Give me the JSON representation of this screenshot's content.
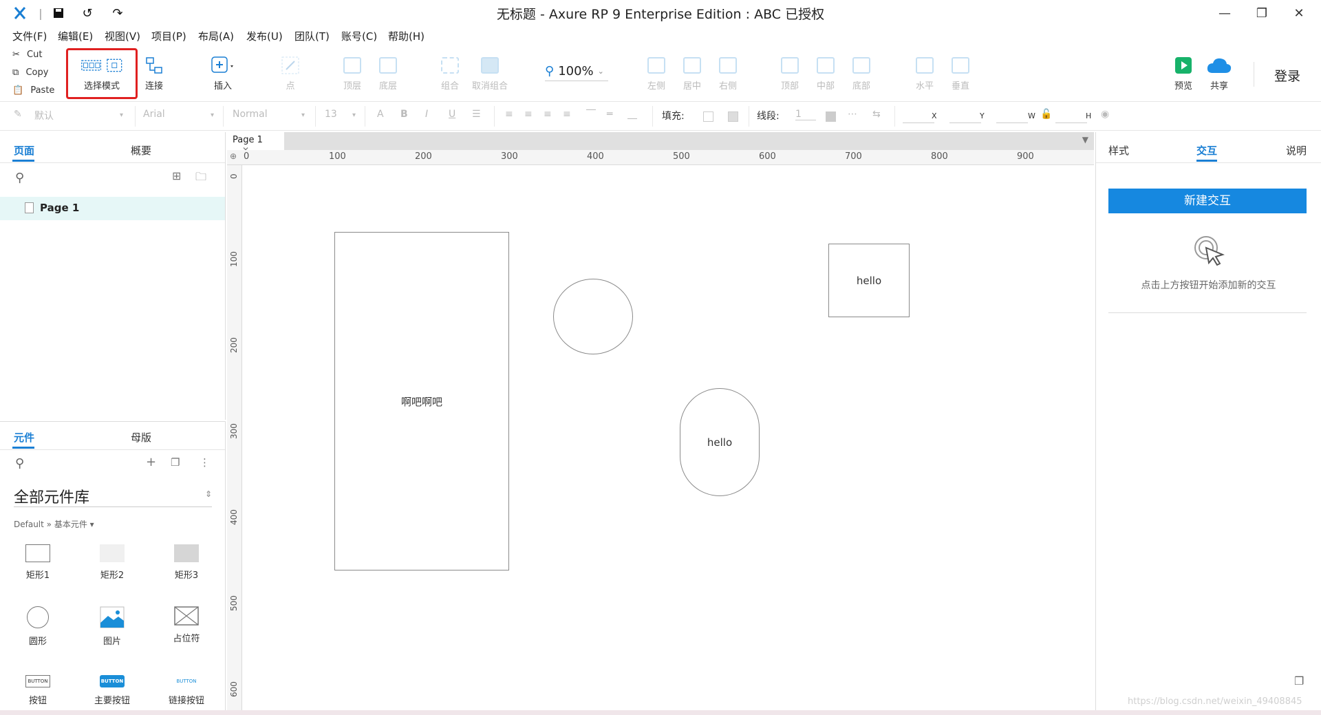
{
  "titlebar": {
    "title": "无标题 - Axure RP 9 Enterprise Edition : ABC 已授权",
    "icons": [
      "axure-logo",
      "save-icon",
      "undo-icon",
      "redo-icon"
    ],
    "window_buttons": [
      "minimize",
      "restore",
      "close"
    ],
    "divider": "|"
  },
  "menubar": {
    "items": [
      "文件(F)",
      "编辑(E)",
      "视图(V)",
      "项目(P)",
      "布局(A)",
      "发布(U)",
      "团队(T)",
      "账号(C)",
      "帮助(H)"
    ]
  },
  "toolbar": {
    "clipboard": [
      "Cut",
      "Copy",
      "Paste"
    ],
    "select_mode": "选择模式",
    "connect": "连接",
    "insert": "插入",
    "point": "点",
    "top_layer": "顶层",
    "bottom_layer": "底层",
    "group": "组合",
    "ungroup": "取消组合",
    "zoom": "100%",
    "align_left": "左侧",
    "align_center": "居中",
    "align_right": "右侧",
    "align_top": "顶部",
    "align_middle": "中部",
    "align_bottom": "底部",
    "distribute_h": "水平",
    "distribute_v": "垂直",
    "preview": "预览",
    "share": "共享",
    "login": "登录",
    "colors": {
      "accent": "#1a7fd4",
      "preview_green": "#17b26a",
      "share_blue": "#1f8fe6",
      "highlight_red": "#e02020"
    }
  },
  "formatbar": {
    "style": "默认",
    "font": "Arial",
    "weight": "Normal",
    "size": "13",
    "fill_label": "填充:",
    "stroke_label": "线段:",
    "stroke_value": "1",
    "x_label": "X",
    "y_label": "Y",
    "w_label": "W",
    "h_label": "H"
  },
  "pages_panel": {
    "tabs": [
      "页面",
      "概要"
    ],
    "page_item": "Page 1"
  },
  "widgets_panel": {
    "tabs": [
      "元件",
      "母版"
    ],
    "library": "全部元件库",
    "breadcrumb": "Default » 基本元件 ▾",
    "items": [
      "矩形1",
      "矩形2",
      "矩形3",
      "圆形",
      "图片",
      "占位符",
      "按钮",
      "主要按钮",
      "链接按钮"
    ],
    "button_caption": "BUTTON"
  },
  "canvas": {
    "tab": "Page 1",
    "ruler_h": [
      "0",
      "100",
      "200",
      "300",
      "400",
      "500",
      "600",
      "700",
      "800",
      "900"
    ],
    "ruler_v": [
      "0",
      "100",
      "200",
      "300",
      "400",
      "500",
      "600"
    ],
    "shapes": {
      "rect_text": "啊吧啊吧",
      "square_text": "hello",
      "pill_text": "hello"
    }
  },
  "right_panel": {
    "tabs": [
      "样式",
      "交互",
      "说明"
    ],
    "new_button": "新建交互",
    "hint": "点击上方按钮开始添加新的交互"
  },
  "watermark": "https://blog.csdn.net/weixin_49408845"
}
